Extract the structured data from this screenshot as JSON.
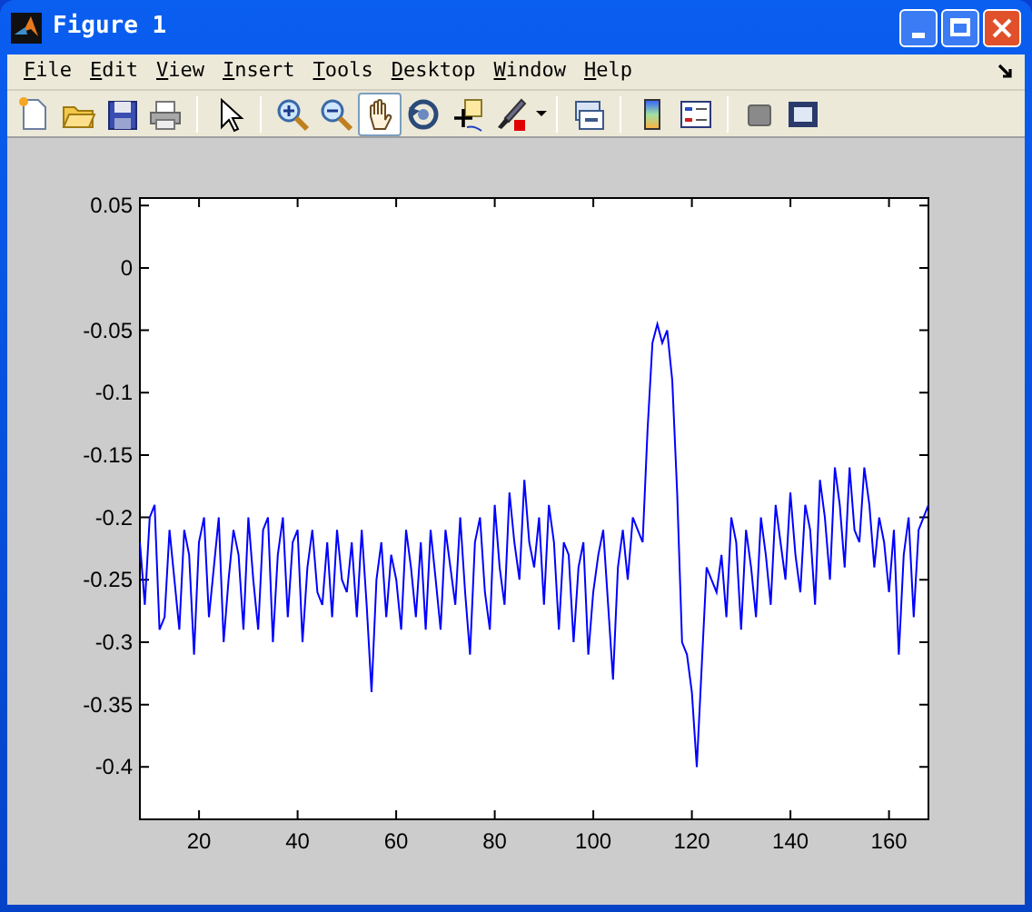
{
  "window": {
    "title": "Figure 1"
  },
  "menu": [
    "File",
    "Edit",
    "View",
    "Insert",
    "Tools",
    "Desktop",
    "Window",
    "Help"
  ],
  "toolbar": [
    [
      {
        "selected": false
      },
      {
        "selected": false
      },
      {
        "selected": false
      },
      {
        "selected": false
      }
    ],
    [
      {
        "selected": false
      }
    ],
    [
      {
        "selected": false
      },
      {
        "selected": false
      },
      {
        "selected": true
      },
      {
        "selected": false
      },
      {
        "selected": false
      },
      {
        "selected": false
      }
    ],
    [
      {
        "selected": false
      }
    ],
    [
      {
        "selected": false
      },
      {
        "selected": false
      }
    ],
    [
      {
        "selected": false
      },
      {
        "selected": false
      }
    ]
  ],
  "axes": {
    "chart_data": {
      "type": "line",
      "xlim": [
        8,
        168
      ],
      "ylim": [
        -0.442,
        0.056
      ],
      "xticks": [
        20,
        40,
        60,
        80,
        100,
        120,
        140,
        160
      ],
      "yticks": [
        {
          "value": 0.05,
          "label": "0.05"
        },
        {
          "value": 0,
          "label": "0"
        },
        {
          "value": -0.05,
          "label": "-0.05"
        },
        {
          "value": -0.1,
          "label": "-0.1"
        },
        {
          "value": -0.15,
          "label": "-0.15"
        },
        {
          "value": -0.2,
          "label": "-0.2"
        },
        {
          "value": -0.25,
          "label": "-0.25"
        },
        {
          "value": -0.3,
          "label": "-0.3"
        },
        {
          "value": -0.35,
          "label": "-0.35"
        },
        {
          "value": -0.4,
          "label": "-0.4"
        }
      ],
      "x": [
        8,
        9,
        10,
        11,
        12,
        13,
        14,
        15,
        16,
        17,
        18,
        19,
        20,
        21,
        22,
        23,
        24,
        25,
        26,
        27,
        28,
        29,
        30,
        31,
        32,
        33,
        34,
        35,
        36,
        37,
        38,
        39,
        40,
        41,
        42,
        43,
        44,
        45,
        46,
        47,
        48,
        49,
        50,
        51,
        52,
        53,
        54,
        55,
        56,
        57,
        58,
        59,
        60,
        61,
        62,
        63,
        64,
        65,
        66,
        67,
        68,
        69,
        70,
        71,
        72,
        73,
        74,
        75,
        76,
        77,
        78,
        79,
        80,
        81,
        82,
        83,
        84,
        85,
        86,
        87,
        88,
        89,
        90,
        91,
        92,
        93,
        94,
        95,
        96,
        97,
        98,
        99,
        100,
        101,
        102,
        103,
        104,
        105,
        106,
        107,
        108,
        109,
        110,
        111,
        112,
        113,
        114,
        115,
        116,
        117,
        118,
        119,
        120,
        121,
        122,
        123,
        124,
        125,
        126,
        127,
        128,
        129,
        130,
        131,
        132,
        133,
        134,
        135,
        136,
        137,
        138,
        139,
        140,
        141,
        142,
        143,
        144,
        145,
        146,
        147,
        148,
        149,
        150,
        151,
        152,
        153,
        154,
        155,
        156,
        157,
        158,
        159,
        160,
        161,
        162,
        163,
        164,
        165,
        166,
        167,
        168
      ],
      "series": [
        {
          "color": "#0000ff",
          "values": [
            -0.22,
            -0.27,
            -0.2,
            -0.19,
            -0.29,
            -0.28,
            -0.21,
            -0.25,
            -0.29,
            -0.21,
            -0.23,
            -0.31,
            -0.22,
            -0.2,
            -0.28,
            -0.24,
            -0.2,
            -0.3,
            -0.25,
            -0.21,
            -0.23,
            -0.29,
            -0.2,
            -0.25,
            -0.29,
            -0.21,
            -0.2,
            -0.3,
            -0.23,
            -0.2,
            -0.28,
            -0.22,
            -0.21,
            -0.3,
            -0.24,
            -0.21,
            -0.26,
            -0.27,
            -0.22,
            -0.28,
            -0.21,
            -0.25,
            -0.26,
            -0.22,
            -0.28,
            -0.21,
            -0.27,
            -0.34,
            -0.25,
            -0.22,
            -0.28,
            -0.23,
            -0.25,
            -0.29,
            -0.21,
            -0.24,
            -0.28,
            -0.22,
            -0.29,
            -0.21,
            -0.25,
            -0.29,
            -0.21,
            -0.24,
            -0.27,
            -0.2,
            -0.26,
            -0.31,
            -0.22,
            -0.2,
            -0.26,
            -0.29,
            -0.19,
            -0.24,
            -0.27,
            -0.18,
            -0.22,
            -0.25,
            -0.17,
            -0.22,
            -0.24,
            -0.2,
            -0.27,
            -0.19,
            -0.22,
            -0.29,
            -0.22,
            -0.23,
            -0.3,
            -0.24,
            -0.22,
            -0.31,
            -0.26,
            -0.23,
            -0.21,
            -0.27,
            -0.33,
            -0.24,
            -0.21,
            -0.25,
            -0.2,
            -0.21,
            -0.22,
            -0.13,
            -0.06,
            -0.045,
            -0.06,
            -0.05,
            -0.09,
            -0.18,
            -0.3,
            -0.31,
            -0.34,
            -0.4,
            -0.32,
            -0.24,
            -0.25,
            -0.26,
            -0.23,
            -0.28,
            -0.2,
            -0.22,
            -0.29,
            -0.21,
            -0.24,
            -0.28,
            -0.2,
            -0.23,
            -0.27,
            -0.19,
            -0.22,
            -0.25,
            -0.18,
            -0.23,
            -0.26,
            -0.19,
            -0.21,
            -0.27,
            -0.17,
            -0.2,
            -0.25,
            -0.16,
            -0.19,
            -0.24,
            -0.16,
            -0.21,
            -0.22,
            -0.16,
            -0.19,
            -0.24,
            -0.2,
            -0.22,
            -0.26,
            -0.21,
            -0.31,
            -0.23,
            -0.2,
            -0.28,
            -0.21,
            -0.2,
            -0.19
          ]
        }
      ]
    }
  }
}
